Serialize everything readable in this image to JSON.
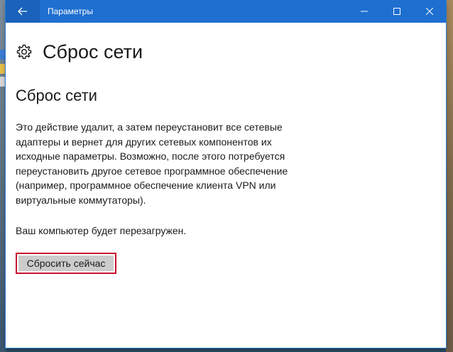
{
  "window": {
    "title": "Параметры"
  },
  "header": {
    "icon": "gear-icon",
    "title": "Сброс сети"
  },
  "section": {
    "title": "Сброс сети",
    "description": "Это действие удалит, а затем переустановит все сетевые\nадаптеры и вернет для других сетевых компонентов их\nисходные параметры. Возможно, после этого потребуется\nпереустановить другое сетевое программное обеспечение\n(например, программное обеспечение клиента VPN или\nвиртуальные коммутаторы).",
    "restart_note": "Ваш компьютер будет перезагружен.",
    "reset_button_label": "Сбросить сейчас"
  },
  "colors": {
    "titlebar": "#1e6fd0",
    "back_button": "#1a62bb",
    "highlight_border": "#c8102e",
    "button_bg": "#cccccc"
  }
}
